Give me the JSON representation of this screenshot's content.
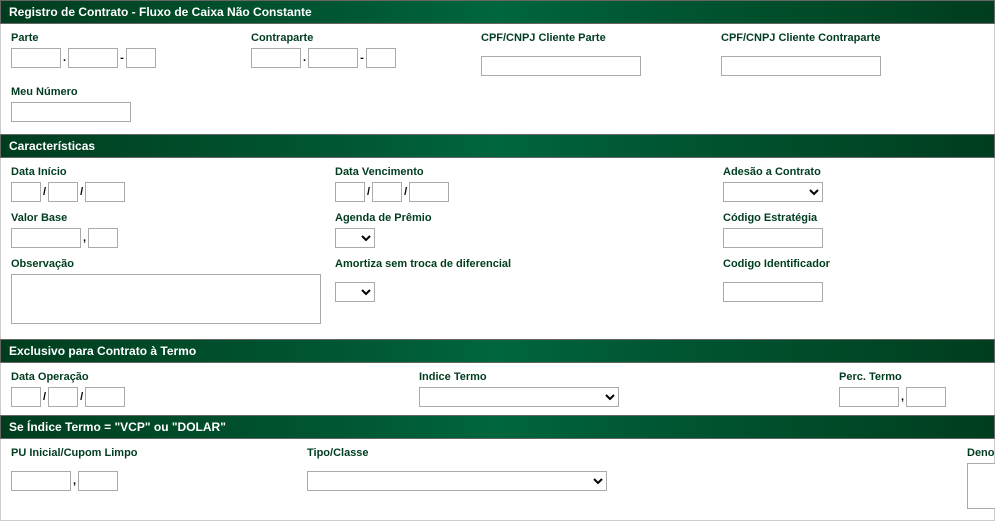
{
  "section1": {
    "title": "Registro de Contrato - Fluxo de Caixa Não Constante",
    "parte_label": "Parte",
    "contraparte_label": "Contraparte",
    "cpf_parte_label": "CPF/CNPJ Cliente Parte",
    "cpf_contraparte_label": "CPF/CNPJ Cliente Contraparte",
    "meu_numero_label": "Meu Número",
    "sep_dot": ".",
    "sep_dash": "-",
    "parte_a": "",
    "parte_b": "",
    "parte_c": "",
    "contraparte_a": "",
    "contraparte_b": "",
    "contraparte_c": "",
    "cpf_parte": "",
    "cpf_contraparte": "",
    "meu_numero": ""
  },
  "section2": {
    "title": "Características",
    "data_inicio_label": "Data Início",
    "data_vencimento_label": "Data Vencimento",
    "adesao_label": "Adesão a Contrato",
    "valor_base_label": "Valor Base",
    "agenda_premio_label": "Agenda de Prêmio",
    "codigo_estrategia_label": "Código Estratégia",
    "observacao_label": "Observação",
    "amortiza_label": "Amortiza sem troca de diferencial",
    "codigo_identificador_label": "Codigo Identificador",
    "sep_slash": "/",
    "sep_comma": ",",
    "data_inicio_d": "",
    "data_inicio_m": "",
    "data_inicio_y": "",
    "data_venc_d": "",
    "data_venc_m": "",
    "data_venc_y": "",
    "adesao": "",
    "valor_base_int": "",
    "valor_base_dec": "",
    "agenda_premio": "",
    "codigo_estrategia": "",
    "observacao": "",
    "amortiza": "",
    "codigo_identificador": ""
  },
  "section3": {
    "title": "Exclusivo para Contrato à Termo",
    "data_operacao_label": "Data Operação",
    "indice_termo_label": "Indice Termo",
    "perc_termo_label": "Perc. Termo",
    "sep_slash": "/",
    "sep_comma": ",",
    "data_op_d": "",
    "data_op_m": "",
    "data_op_y": "",
    "indice_termo": "",
    "perc_termo_int": "",
    "perc_termo_dec": ""
  },
  "section4": {
    "title": "Se Índice Termo = \"VCP\" ou \"DOLAR\"",
    "pu_inicial_label": "PU Inicial/Cupom Limpo",
    "tipo_classe_label": "Tipo/Classe",
    "denominacao_label": "Denominação",
    "sep_comma": ",",
    "pu_inicial_int": "",
    "pu_inicial_dec": "",
    "tipo_classe": "",
    "denominacao": ""
  }
}
